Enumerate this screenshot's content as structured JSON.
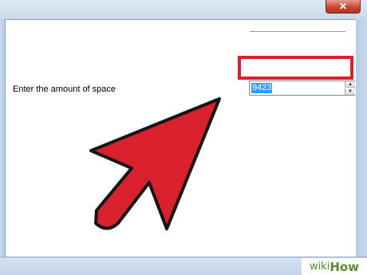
{
  "window": {
    "close_glyph": "✕"
  },
  "dialog": {
    "prompt_label": "Enter the amount of space",
    "spin_value": "9423",
    "spin_up_glyph": "▲",
    "spin_down_glyph": "▼"
  },
  "watermark": {
    "wiki": "wiki",
    "how": "How"
  },
  "colors": {
    "annotation_red": "#d9212e",
    "selection_blue": "#3399ff"
  }
}
